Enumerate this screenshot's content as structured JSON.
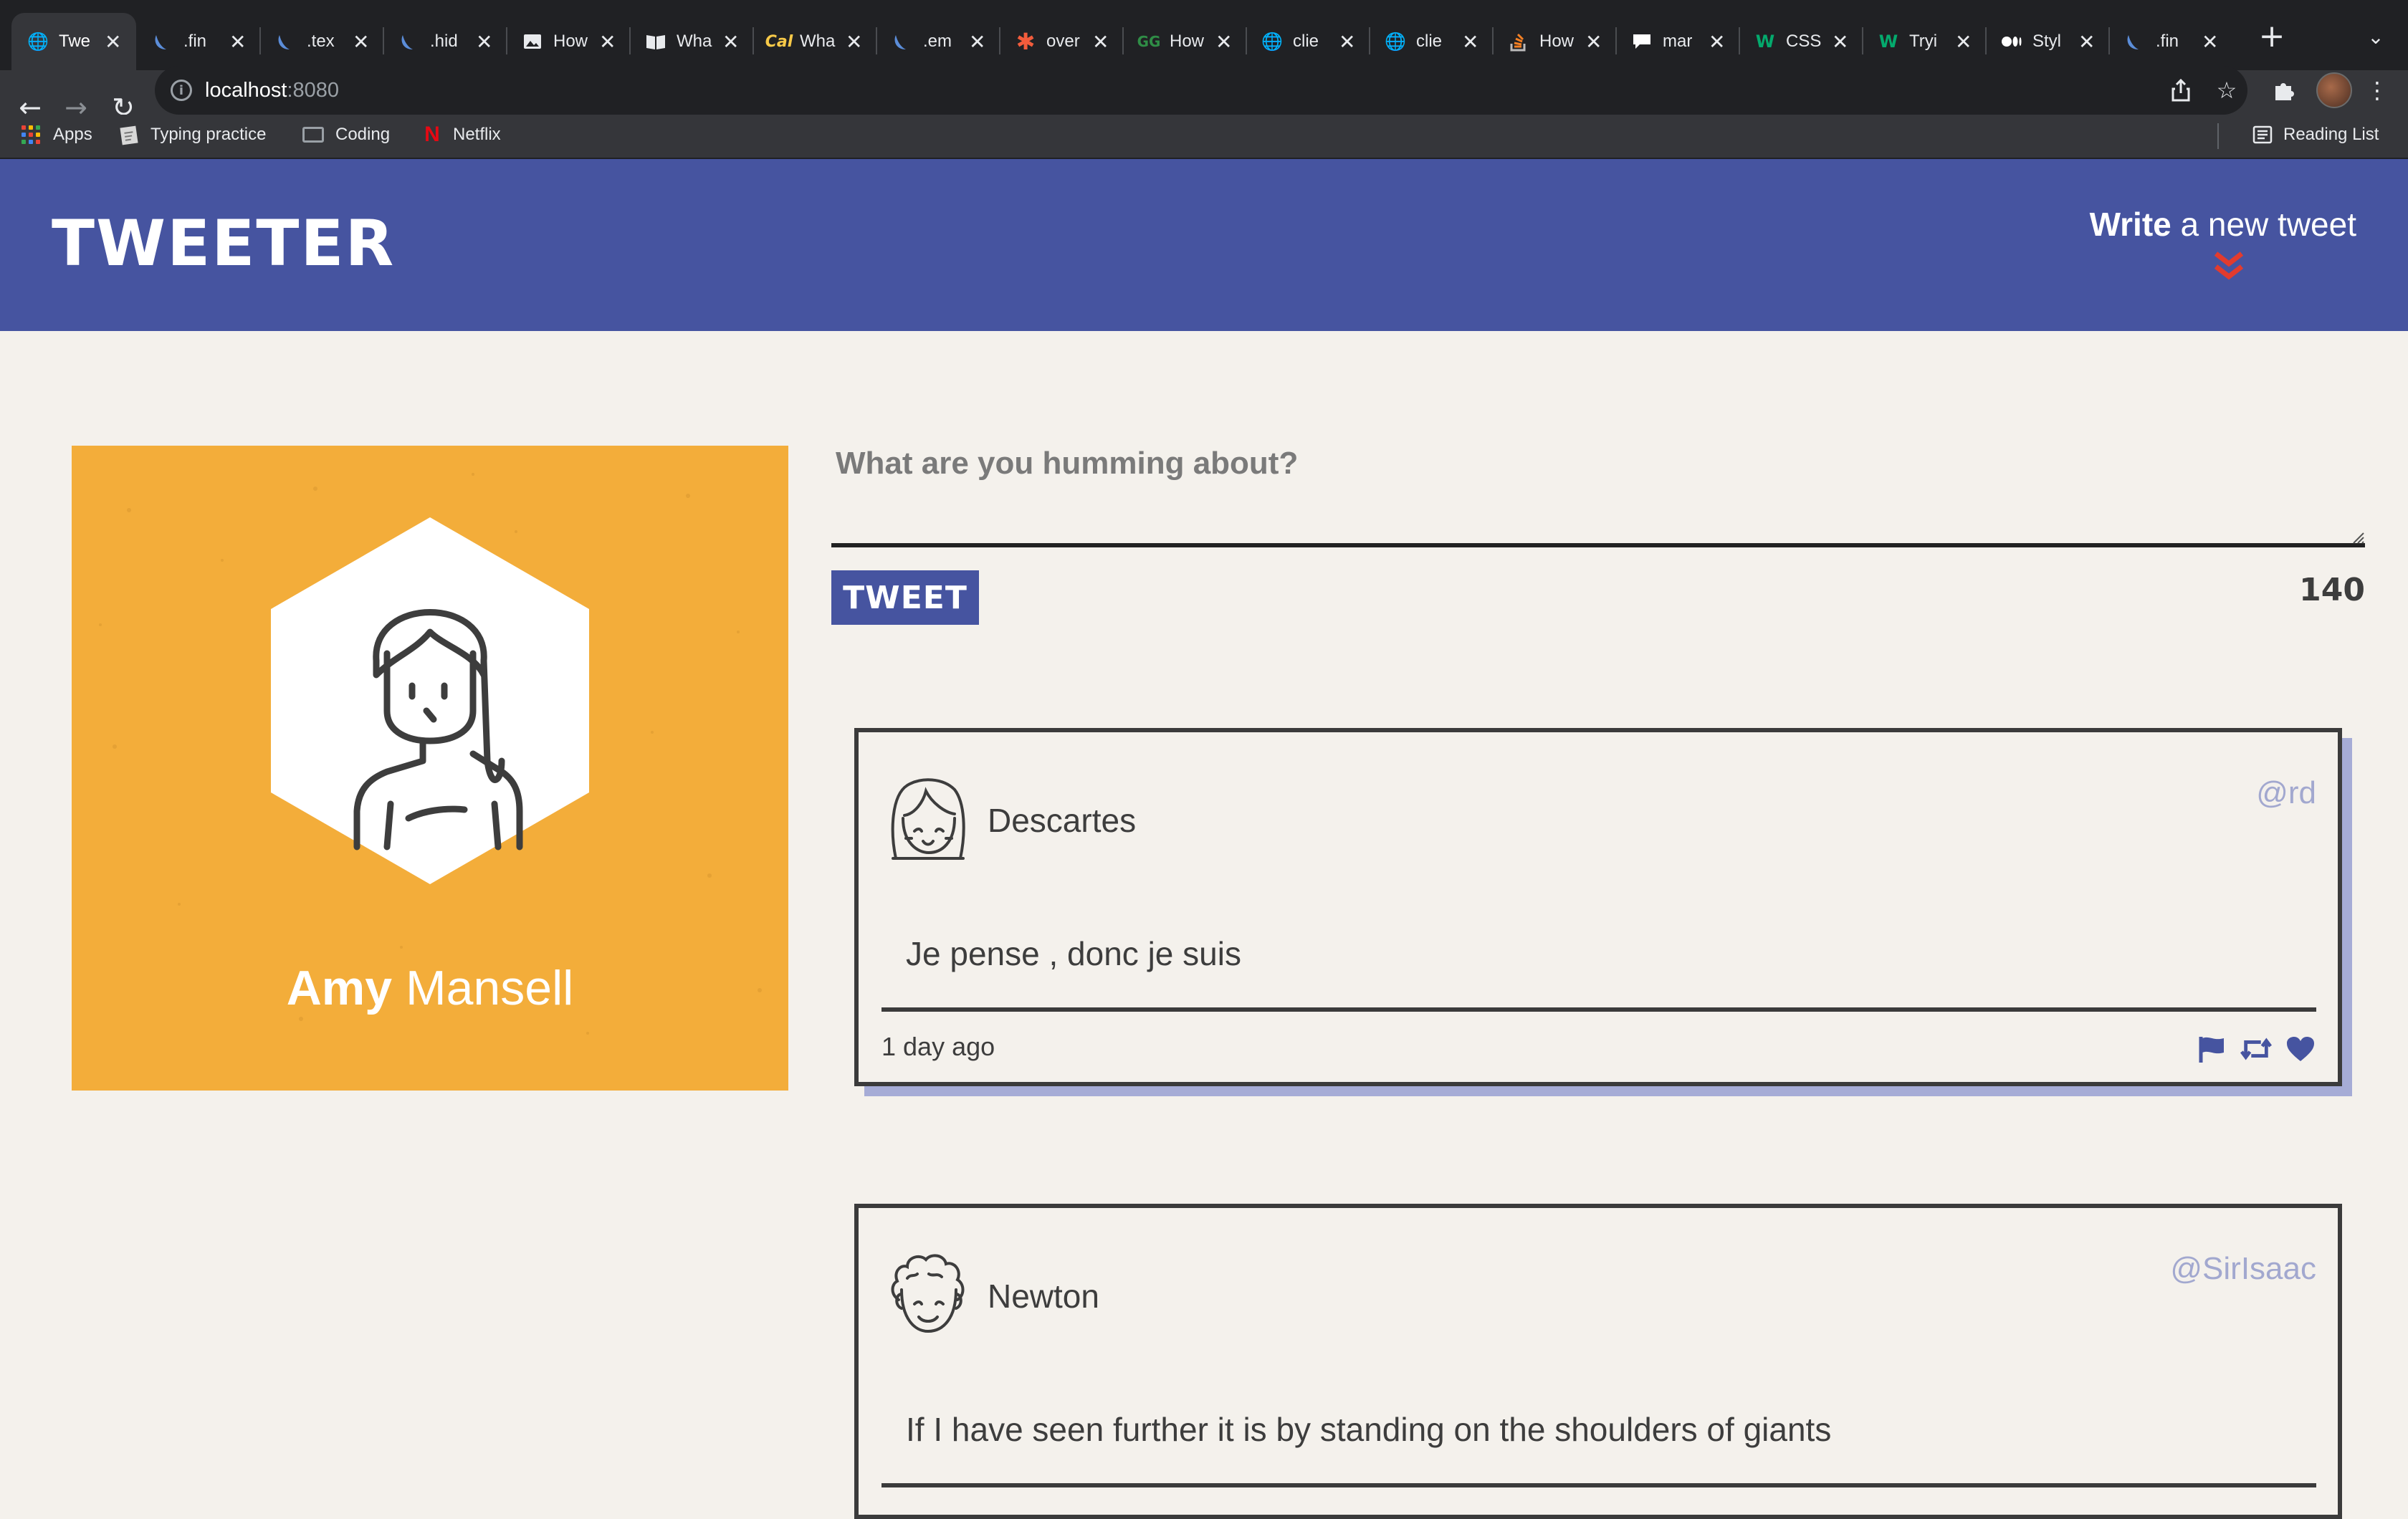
{
  "browser": {
    "tabs": [
      {
        "title": "Twe",
        "icon": "globe-icon",
        "active": true
      },
      {
        "title": ".fin",
        "icon": "jquery-icon"
      },
      {
        "title": ".tex",
        "icon": "jquery-icon"
      },
      {
        "title": ".hid",
        "icon": "jquery-icon"
      },
      {
        "title": "How",
        "icon": "picture-icon"
      },
      {
        "title": "Wha",
        "icon": "book-icon"
      },
      {
        "title": "Wha",
        "icon": "cal-icon"
      },
      {
        "title": ".em",
        "icon": "jquery-icon"
      },
      {
        "title": "over",
        "icon": "asterisk-icon"
      },
      {
        "title": "How",
        "icon": "geeks-icon"
      },
      {
        "title": "clie",
        "icon": "globe-icon"
      },
      {
        "title": "clie",
        "icon": "globe-icon"
      },
      {
        "title": "How",
        "icon": "stackoverflow-icon"
      },
      {
        "title": "mar",
        "icon": "speech-icon"
      },
      {
        "title": "CSS",
        "icon": "w3-icon"
      },
      {
        "title": "Tryi",
        "icon": "w3-icon"
      },
      {
        "title": "Styl",
        "icon": "medium-icon"
      },
      {
        "title": ".fin",
        "icon": "jquery-icon"
      }
    ],
    "url_host": "localhost",
    "url_port": ":8080",
    "bookmarks": [
      "Apps",
      "Typing practice",
      "Coding",
      "Netflix"
    ],
    "reading_list": "Reading List"
  },
  "app": {
    "logo": "TWEETER",
    "compose_bold": "Write",
    "compose_rest": " a new tweet",
    "accent": "#4654a0",
    "error_red": "#e23b2e"
  },
  "profile": {
    "first_name": "Amy",
    "last_name": " Mansell",
    "card_color": "#f3ad3a"
  },
  "composer": {
    "placeholder": "What are you humming about?",
    "button_label": "TWEET",
    "counter": "140"
  },
  "tweets": [
    {
      "name": "Descartes",
      "handle": "@rd",
      "text": "Je pense , donc je suis",
      "time": "1 day ago"
    },
    {
      "name": "Newton",
      "handle": "@SirIsaac",
      "text": "If I have seen further it is by standing on the shoulders of giants"
    }
  ]
}
